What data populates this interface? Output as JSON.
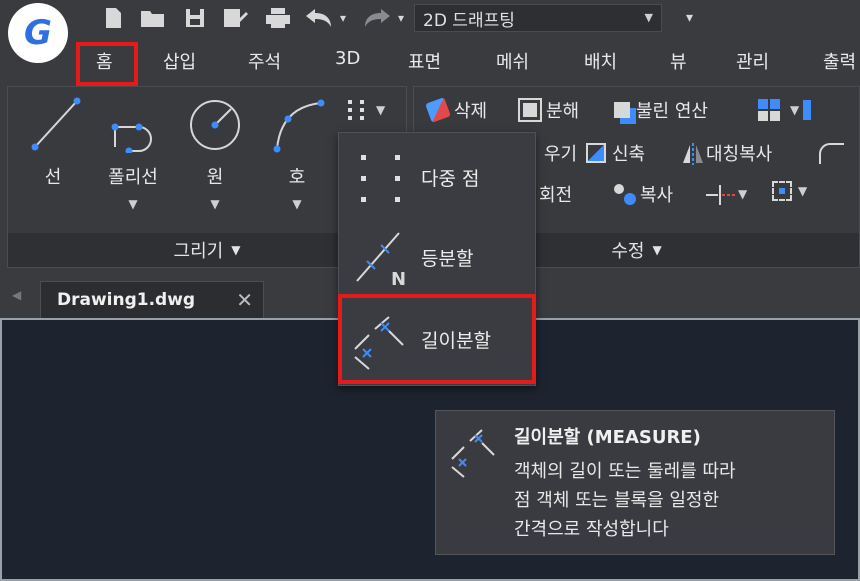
{
  "app": {
    "logo_letter": "G",
    "workspace": "2D 드래프팅"
  },
  "ribbon_tabs": [
    "홈",
    "삽입",
    "주석",
    "3D",
    "표면",
    "메쉬",
    "배치",
    "뷰",
    "관리",
    "출력"
  ],
  "draw_panel": {
    "title": "그리기",
    "tools": [
      "선",
      "폴리선",
      "원",
      "호"
    ]
  },
  "modify_panel": {
    "title": "수정",
    "items": {
      "erase": "삭제",
      "explode": "분해",
      "boolean": "불린 연산",
      "stretch": "우기",
      "scale": "신축",
      "mirror": "대칭복사",
      "rotate": "회전",
      "copy": "복사"
    }
  },
  "point_flyout": {
    "items": [
      "다중 점",
      "등분할",
      "길이분할"
    ]
  },
  "document": {
    "tab_label": "Drawing1.dwg"
  },
  "tooltip": {
    "title": "길이분할 (MEASURE)",
    "lines": [
      "객체의 길이 또는 둘레를 따라",
      "점 객체 또는 블록을 일정한",
      "간격으로 작성합니다"
    ]
  },
  "colors": {
    "highlight": "#e51b1b",
    "accent_blue": "#3d8bfd",
    "canvas": "#1d2430"
  }
}
